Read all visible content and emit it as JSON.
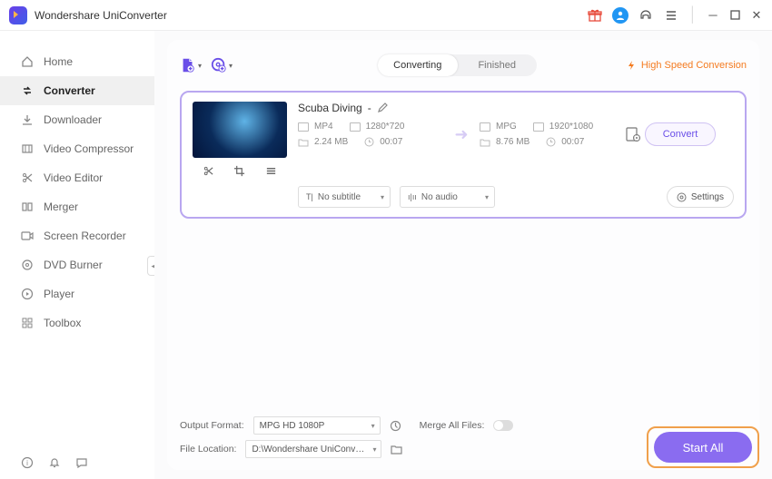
{
  "app": {
    "title": "Wondershare UniConverter"
  },
  "titlebar_icons": {
    "gift": "gift-icon",
    "user": "user-avatar",
    "headset": "support-icon",
    "menu": "menu-icon",
    "min": "minimize-icon",
    "max": "maximize-icon",
    "close": "close-icon"
  },
  "sidebar": {
    "items": [
      {
        "label": "Home",
        "icon": "home-icon"
      },
      {
        "label": "Converter",
        "icon": "converter-icon",
        "active": true
      },
      {
        "label": "Downloader",
        "icon": "download-icon"
      },
      {
        "label": "Video Compressor",
        "icon": "compress-icon"
      },
      {
        "label": "Video Editor",
        "icon": "scissors-icon"
      },
      {
        "label": "Merger",
        "icon": "merge-icon"
      },
      {
        "label": "Screen Recorder",
        "icon": "record-icon"
      },
      {
        "label": "DVD Burner",
        "icon": "dvd-icon"
      },
      {
        "label": "Player",
        "icon": "play-icon"
      },
      {
        "label": "Toolbox",
        "icon": "toolbox-icon"
      }
    ],
    "bottom": {
      "about": "about-icon",
      "bell": "bell-icon",
      "feedback": "feedback-icon"
    }
  },
  "tabs": {
    "converting": "Converting",
    "finished": "Finished",
    "active": "converting"
  },
  "hsc": "High Speed Conversion",
  "file": {
    "title": "Scuba Diving",
    "sep": "-",
    "src": {
      "format": "MP4",
      "res": "1280*720",
      "size": "2.24 MB",
      "dur": "00:07"
    },
    "dst": {
      "format": "MPG",
      "res": "1920*1080",
      "size": "8.76 MB",
      "dur": "00:07"
    },
    "subtitle": "No subtitle",
    "audio": "No audio",
    "settings": "Settings",
    "convert": "Convert"
  },
  "footer": {
    "of_label": "Output Format:",
    "of_value": "MPG HD 1080P",
    "merge_label": "Merge All Files:",
    "fl_label": "File Location:",
    "fl_value": "D:\\Wondershare UniConverter",
    "start_all": "Start All"
  }
}
